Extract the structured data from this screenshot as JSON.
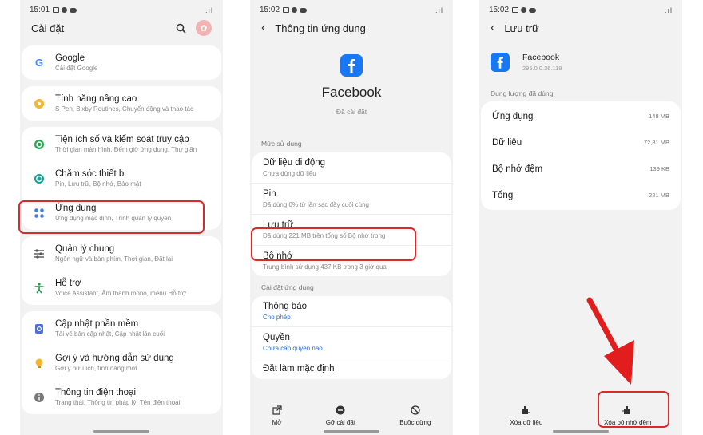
{
  "status": {
    "time1": "15:01",
    "time2": "15:02",
    "time3": "15:02",
    "signal": ".ıl"
  },
  "settings": {
    "title": "Cài đặt",
    "items": [
      {
        "title": "Google",
        "sub": "Cài đặt Google"
      },
      {
        "title": "Tính năng nâng cao",
        "sub": "S Pen, Bixby Routines, Chuyển động và thao tác"
      },
      {
        "title": "Tiện ích số và kiểm soát truy cập",
        "sub": "Thời gian màn hình, Đếm giờ ứng dụng, Thư giãn"
      },
      {
        "title": "Chăm sóc thiết bị",
        "sub": "Pin, Lưu trữ, Bộ nhớ, Bảo mật"
      },
      {
        "title": "Ứng dụng",
        "sub": "Ứng dụng mặc định, Trình quản lý quyền"
      },
      {
        "title": "Quản lý chung",
        "sub": "Ngôn ngữ và bàn phím, Thời gian, Đặt lại"
      },
      {
        "title": "Hỗ trợ",
        "sub": "Voice Assistant, Âm thanh mono, menu Hỗ trợ"
      },
      {
        "title": "Cập nhật phần mềm",
        "sub": "Tải về bản cập nhật, Cập nhật lần cuối"
      },
      {
        "title": "Gợi ý và hướng dẫn sử dụng",
        "sub": "Gợi ý hữu ích, tính năng mới"
      },
      {
        "title": "Thông tin điện thoại",
        "sub": "Trạng thái, Thông tin pháp lý, Tên điện thoại"
      }
    ]
  },
  "appinfo": {
    "title": "Thông tin ứng dụng",
    "app_name": "Facebook",
    "app_status": "Đã cài đặt",
    "section_usage": "Mức sử dụng",
    "usage_items": [
      {
        "title": "Dữ liệu di động",
        "sub": "Chưa dùng dữ liệu"
      },
      {
        "title": "Pin",
        "sub": "Đã dùng 0% từ lần sạc đầy cuối cùng"
      },
      {
        "title": "Lưu trữ",
        "sub": "Đã dùng 221 MB trên tổng số Bộ nhớ trong"
      },
      {
        "title": "Bộ nhớ",
        "sub": "Trung bình sử dụng 437 KB trong 3 giờ qua"
      }
    ],
    "section_settings": "Cài đặt ứng dụng",
    "settings_items": [
      {
        "title": "Thông báo",
        "sub": "Cho phép"
      },
      {
        "title": "Quyền",
        "sub": "Chưa cấp quyền nào"
      },
      {
        "title": "Đặt làm mặc định",
        "sub": ""
      }
    ],
    "bottom": {
      "open": "Mở",
      "uninstall": "Gỡ cài đặt",
      "stop": "Buộc dừng"
    }
  },
  "storage": {
    "title": "Lưu trữ",
    "app_name": "Facebook",
    "version": "295.0.0.36.119",
    "section": "Dung lượng đã dùng",
    "rows": [
      {
        "label": "Ứng dụng",
        "value": "148 MB"
      },
      {
        "label": "Dữ liệu",
        "value": "72,81 MB"
      },
      {
        "label": "Bộ nhớ đệm",
        "value": "139 KB"
      },
      {
        "label": "Tổng",
        "value": "221 MB"
      }
    ],
    "bottom": {
      "clear_data": "Xóa dữ liệu",
      "clear_cache": "Xóa bộ nhớ đệm"
    }
  },
  "colors": {
    "accent_red": "#d92b2b",
    "facebook_blue": "#1877f2",
    "link_blue": "#2a6bd6"
  }
}
